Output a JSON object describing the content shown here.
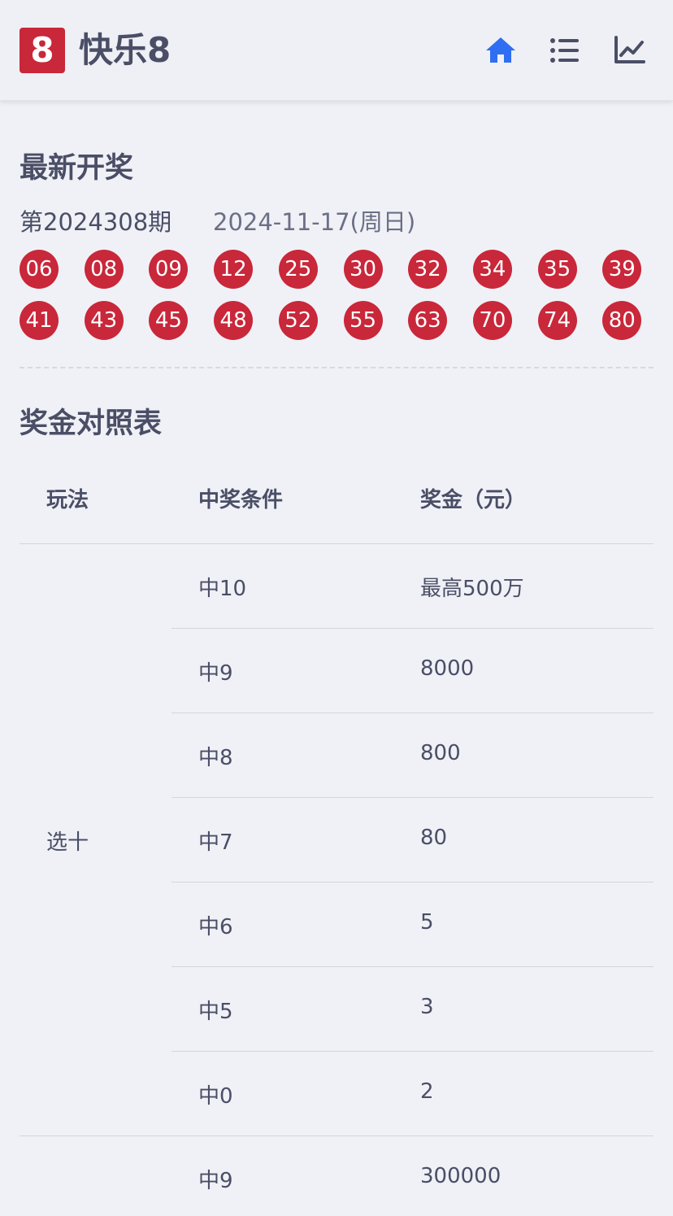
{
  "header": {
    "logo_text": "8",
    "title": "快乐8",
    "icons": [
      "home-icon",
      "list-icon",
      "chart-icon"
    ],
    "accent_color": "#2f6ef2",
    "brand_color": "#c9273a"
  },
  "latest": {
    "title": "最新开奖",
    "issue": "第2024308期",
    "date": "2024-11-17(周日)",
    "numbers": [
      "06",
      "08",
      "09",
      "12",
      "25",
      "30",
      "32",
      "34",
      "35",
      "39",
      "41",
      "43",
      "45",
      "48",
      "52",
      "55",
      "63",
      "70",
      "74",
      "80"
    ]
  },
  "prize_table": {
    "title": "奖金对照表",
    "headers": [
      "玩法",
      "中奖条件",
      "奖金（元）"
    ],
    "groups": [
      {
        "play": "选十",
        "rows": [
          {
            "condition": "中10",
            "prize": "最高500万"
          },
          {
            "condition": "中9",
            "prize": "8000"
          },
          {
            "condition": "中8",
            "prize": "800"
          },
          {
            "condition": "中7",
            "prize": "80"
          },
          {
            "condition": "中6",
            "prize": "5"
          },
          {
            "condition": "中5",
            "prize": "3"
          },
          {
            "condition": "中0",
            "prize": "2"
          }
        ]
      },
      {
        "play": "",
        "rows": [
          {
            "condition": "中9",
            "prize": "300000"
          }
        ]
      }
    ]
  }
}
